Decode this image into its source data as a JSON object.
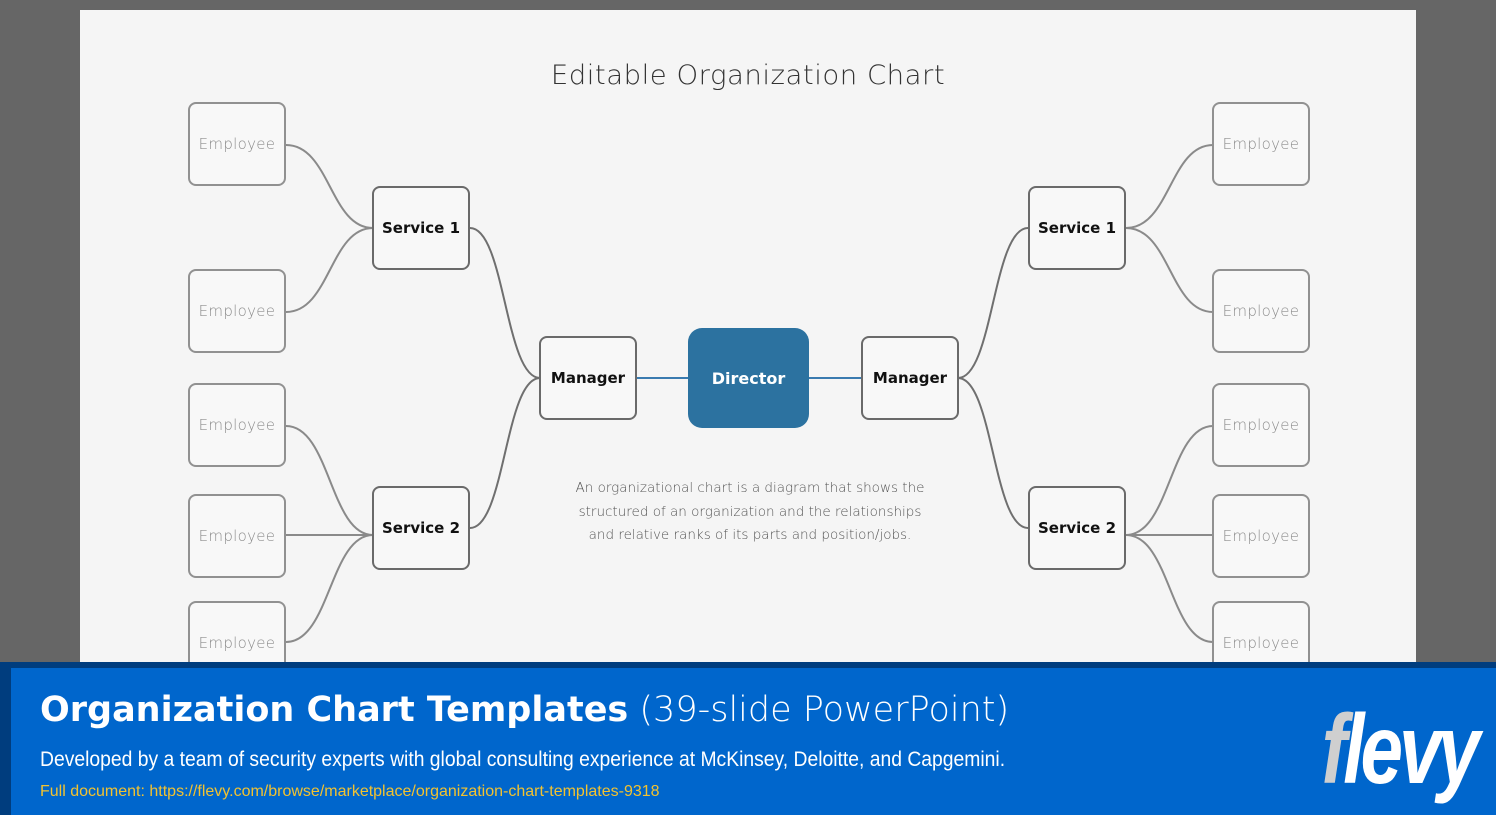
{
  "slide": {
    "title": "Editable Organization Chart",
    "description": [
      "An organizational chart is a diagram that shows the",
      "structured of an organization and the relationships",
      "and relative ranks of its parts and position/jobs."
    ],
    "accent_color": "#2c72a0",
    "org": {
      "director": "Director",
      "left": {
        "manager": "Manager",
        "service1": {
          "label": "Service 1",
          "employees": [
            "Employee",
            "Employee"
          ]
        },
        "service2": {
          "label": "Service 2",
          "employees": [
            "Employee",
            "Employee",
            "Employee"
          ]
        }
      },
      "right": {
        "manager": "Manager",
        "service1": {
          "label": "Service 1",
          "employees": [
            "Employee",
            "Employee"
          ]
        },
        "service2": {
          "label": "Service 2",
          "employees": [
            "Employee",
            "Employee",
            "Employee"
          ]
        }
      }
    }
  },
  "banner": {
    "title_strong": "Organization Chart Templates",
    "title_light": " (39-slide PowerPoint)",
    "subtitle": "Developed by a team of security experts with global consulting experience at McKinsey, Deloitte, and Capgemini.",
    "link_text": "Full document: https://flevy.com/browse/marketplace/organization-chart-templates-9318",
    "logo_f": "f",
    "logo_rest": "levy",
    "background_color": "#0066cc",
    "link_color": "#f2c230"
  }
}
